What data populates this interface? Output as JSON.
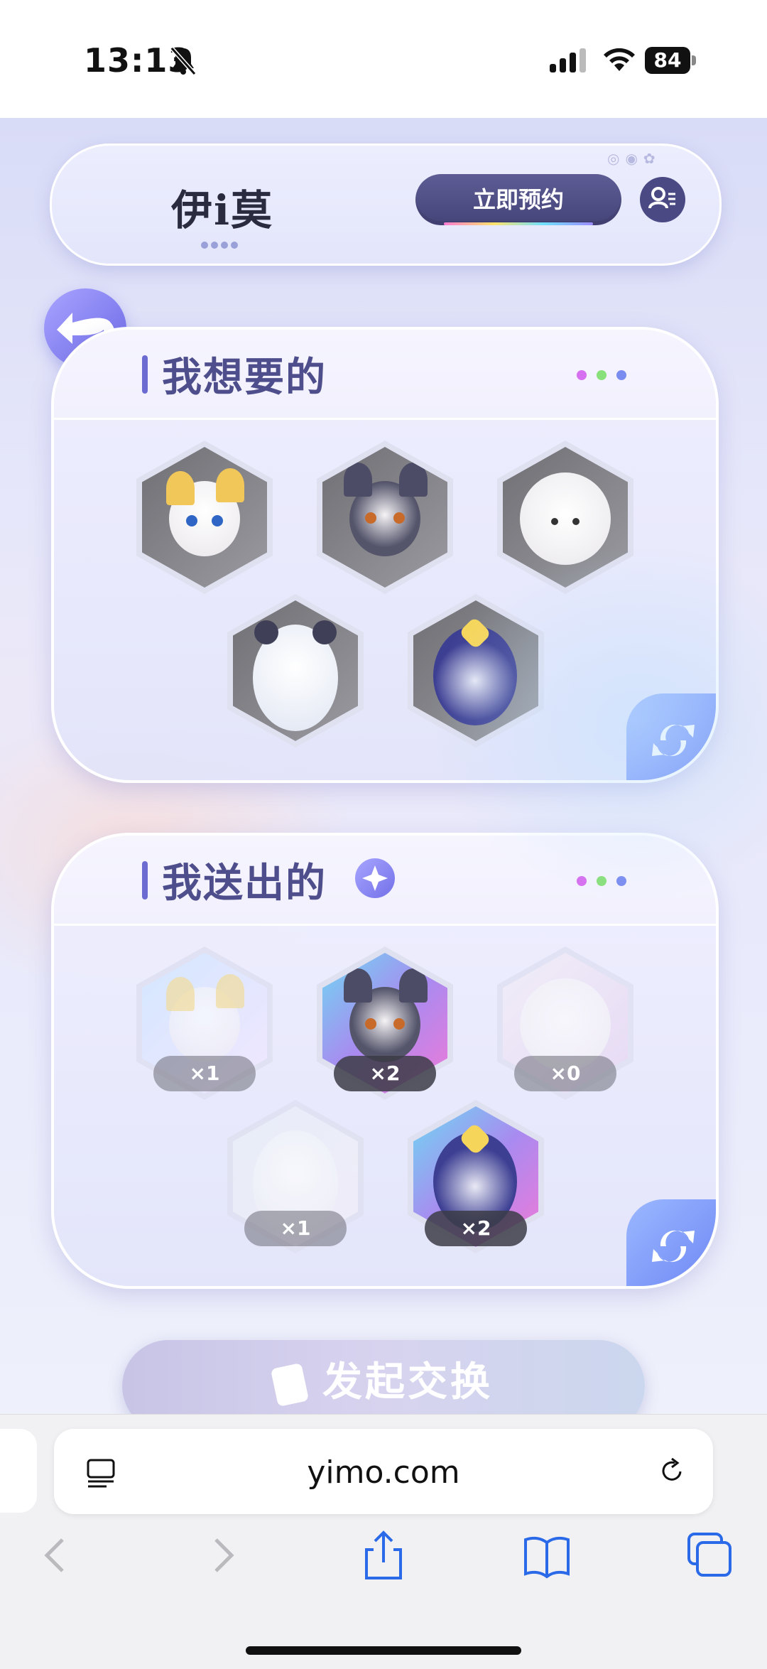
{
  "status": {
    "time": "13:13",
    "battery": "84"
  },
  "header": {
    "logo": "伊i莫",
    "reserve_label": "立即预约"
  },
  "wanted": {
    "title": "我想要的",
    "items": [
      {
        "name": "cream-fox-cloud"
      },
      {
        "name": "gray-fox"
      },
      {
        "name": "sheep"
      },
      {
        "name": "white-bear"
      },
      {
        "name": "blue-squirrel"
      }
    ]
  },
  "given": {
    "title": "我送出的",
    "items": [
      {
        "name": "cream-fox-cloud",
        "count": "×1"
      },
      {
        "name": "gray-fox",
        "count": "×2"
      },
      {
        "name": "sheep",
        "count": "×0"
      },
      {
        "name": "white-bear",
        "count": "×1"
      },
      {
        "name": "blue-squirrel",
        "count": "×2"
      }
    ]
  },
  "exchange": {
    "label": "发起交换"
  },
  "browser": {
    "url": "yimo.com"
  },
  "colors": {
    "accent": "#6c6bd2",
    "title": "#4f4e8c",
    "reserve_btn": "#4f4e86"
  }
}
